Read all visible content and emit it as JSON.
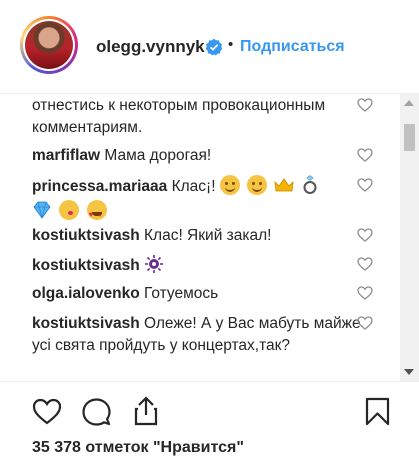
{
  "header": {
    "username": "olegg.vynnyk",
    "separator": "•",
    "follow_label": "Подписаться"
  },
  "comments": [
    {
      "user": "",
      "text": "отнестись к некоторым провокационным комментариям."
    },
    {
      "user": "marfiflaw",
      "text": "Мама дорогая!"
    },
    {
      "user": "princessa.mariaaa",
      "text": "Клас¡!",
      "emojis": [
        "hugging-face",
        "hugging-face",
        "crown",
        "ring",
        "gem",
        "kissing-face",
        "heart-eyes-face"
      ]
    },
    {
      "user": "kostiuktsivash",
      "text": "Клас! Який закал!"
    },
    {
      "user": "kostiuktsivash",
      "text": "",
      "emojis": [
        "microbe"
      ]
    },
    {
      "user": "olga.ialovenko",
      "text": "Готуемось"
    },
    {
      "user": "kostiuktsivash",
      "text": "Олеже! А у Вас мабуть майже усі свята пройдуть у концертах,так?"
    }
  ],
  "likes_text": "35 378 отметок \"Нравится\"",
  "icons": {
    "verified": "verified-badge-icon",
    "like": "heart-outline-icon",
    "comment": "comment-bubble-icon",
    "share": "share-upload-icon",
    "save": "bookmark-icon"
  },
  "colors": {
    "accent": "#3897f0",
    "text": "#262626",
    "border": "#efefef"
  }
}
